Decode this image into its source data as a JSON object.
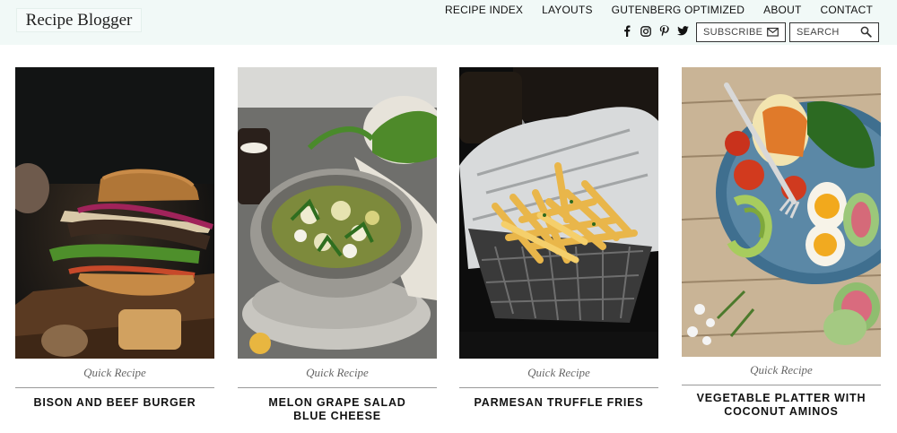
{
  "site": {
    "logo": "Recipe Blogger"
  },
  "nav": [
    "RECIPE INDEX",
    "LAYOUTS",
    "GUTENBERG OPTIMIZED",
    "ABOUT",
    "CONTACT"
  ],
  "social": [
    "facebook-icon",
    "instagram-icon",
    "pinterest-icon",
    "twitter-icon"
  ],
  "subscribe": {
    "label": "SUBSCRIBE",
    "icon": "envelope-icon"
  },
  "search": {
    "placeholder": "SEARCH",
    "icon": "search-icon"
  },
  "colors": {
    "header_bg": "#f1f9f7",
    "text": "#111111",
    "category": "#666666"
  },
  "recipes": [
    {
      "category": "Quick Recipe",
      "title": "BISON AND BEEF BURGER"
    },
    {
      "category": "Quick Recipe",
      "title": "MELON GRAPE SALAD BLUE CHEESE"
    },
    {
      "category": "Quick Recipe",
      "title": "PARMESAN TRUFFLE FRIES"
    },
    {
      "category": "Quick Recipe",
      "title": "VEGETABLE PLATTER WITH COCONUT AMINOS"
    }
  ]
}
